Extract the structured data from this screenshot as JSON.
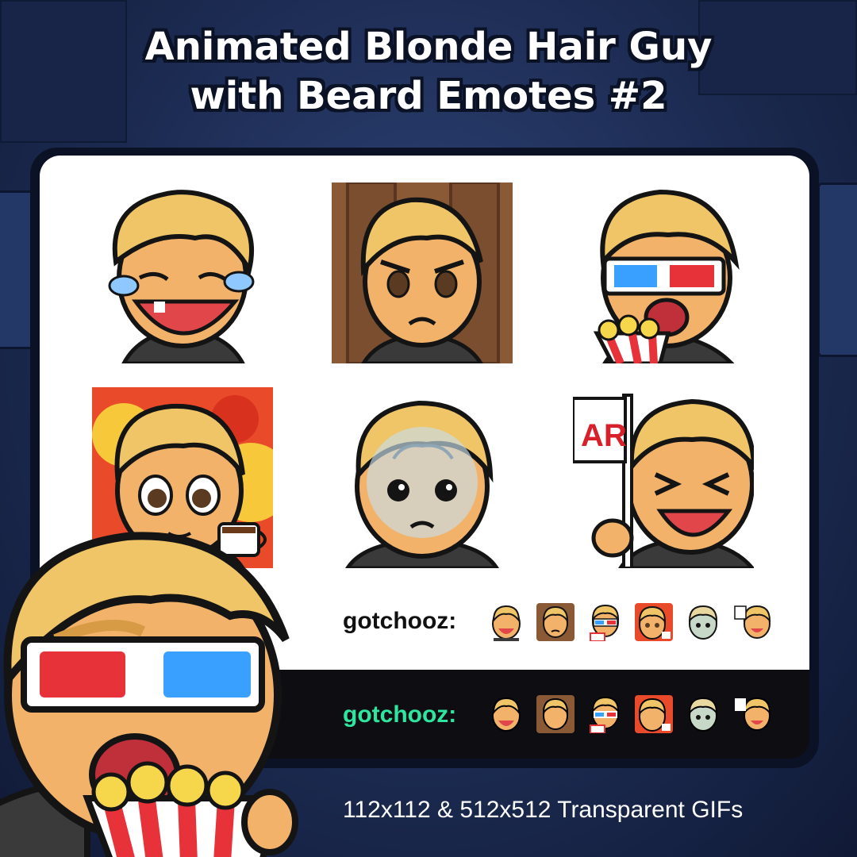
{
  "title": {
    "line1": "Animated Blonde Hair Guy",
    "line2": "with Beard Emotes #2"
  },
  "emotes": [
    {
      "icon": "laughing-crying-emote-icon",
      "bg": "transparent"
    },
    {
      "icon": "annoyed-emote-icon",
      "bg": "#8a5a36"
    },
    {
      "icon": "3d-glasses-popcorn-emote-icon",
      "bg": "transparent"
    },
    {
      "icon": "coffee-fire-emote-icon",
      "bg": "#e84a2a"
    },
    {
      "icon": "brain-fog-emote-icon",
      "bg": "transparent"
    },
    {
      "icon": "flag-cheer-emote-icon",
      "bg": "transparent"
    }
  ],
  "flag_text": "AR",
  "chat": {
    "light_username": "gotchooz:",
    "dark_username": "gotchooz:",
    "dark_username_color": "#2ee6a0"
  },
  "footer": "112x112 & 512x512 Transparent GIFs",
  "colors": {
    "hair": "#f0c567",
    "skin": "#f2b26a",
    "outline": "#141414",
    "shirt": "#3a3a3a",
    "background": "#1c2b52"
  }
}
